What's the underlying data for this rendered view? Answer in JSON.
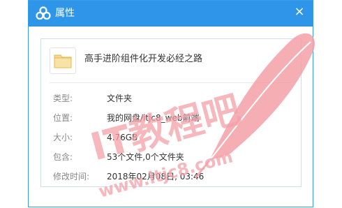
{
  "dialog": {
    "title": "属性",
    "logo_icon": "baidu-netdisk-cloud-icon",
    "close_icon": "close-icon",
    "close_symbol": "×"
  },
  "folder": {
    "icon": "folder-icon",
    "name": "高手进阶组件化开发必经之路"
  },
  "properties": [
    {
      "label": "类型:",
      "value": "文件夹"
    },
    {
      "label": "位置:",
      "value": "我的网盘/itjc8_web前端"
    },
    {
      "label": "大小:",
      "value": "4.76GB"
    },
    {
      "label": "包含:",
      "value": "53个文件,0个文件夹"
    },
    {
      "label": "修改时间:",
      "value": "2018年02月08日, 03:46"
    }
  ],
  "watermark": {
    "text": "IT教程吧",
    "url": "www.itjc8.com",
    "icon": "quill-feather-icon",
    "color": "#f4a0a8"
  }
}
